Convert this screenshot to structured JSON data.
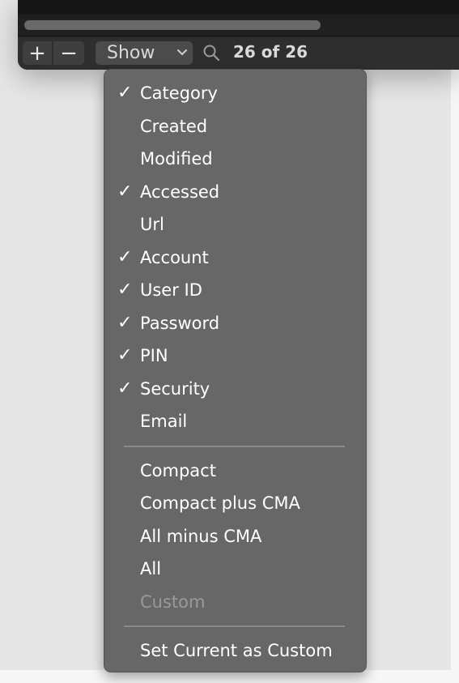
{
  "toolbar": {
    "add_label": "+",
    "remove_label": "−",
    "show_label": "Show",
    "count_text": "26 of 26"
  },
  "menu": {
    "columns": [
      {
        "label": "Category",
        "checked": true
      },
      {
        "label": "Created",
        "checked": false
      },
      {
        "label": "Modified",
        "checked": false
      },
      {
        "label": "Accessed",
        "checked": true
      },
      {
        "label": "Url",
        "checked": false
      },
      {
        "label": "Account",
        "checked": true
      },
      {
        "label": "User ID",
        "checked": true
      },
      {
        "label": "Password",
        "checked": true
      },
      {
        "label": "PIN",
        "checked": true
      },
      {
        "label": "Security",
        "checked": true
      },
      {
        "label": "Email",
        "checked": false
      }
    ],
    "presets": [
      {
        "label": "Compact",
        "enabled": true
      },
      {
        "label": "Compact plus CMA",
        "enabled": true
      },
      {
        "label": "All minus CMA",
        "enabled": true
      },
      {
        "label": "All",
        "enabled": true
      },
      {
        "label": "Custom",
        "enabled": false
      }
    ],
    "set_custom_label": "Set Current as Custom",
    "check_glyph": "✓"
  }
}
